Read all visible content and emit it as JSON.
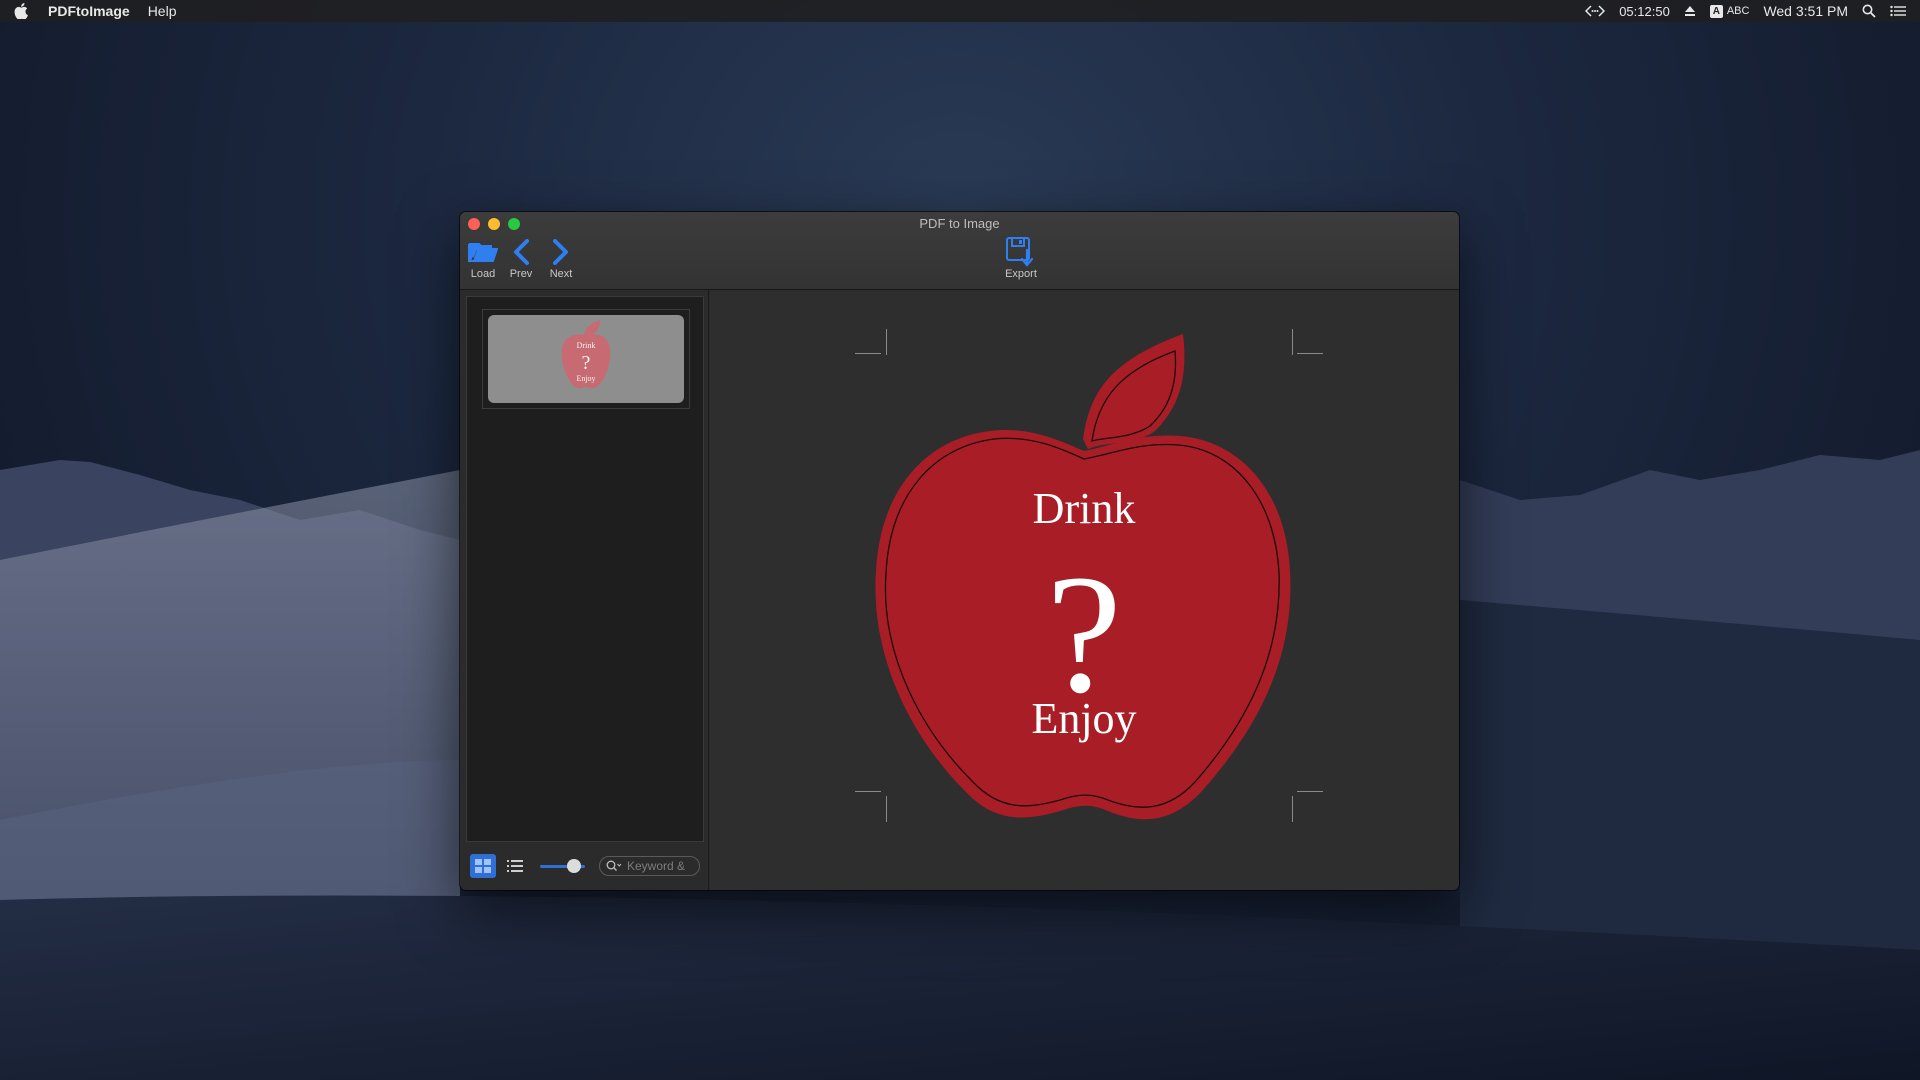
{
  "menubar": {
    "app_name": "PDFtoImage",
    "menus": [
      "Help"
    ],
    "clock_timer": "05:12:50",
    "input_source": "ABC",
    "input_badge": "A",
    "datetime": "Wed 3:51 PM"
  },
  "window": {
    "title": "PDF to Image",
    "toolbar": {
      "load_label": "Load",
      "prev_label": "Prev",
      "next_label": "Next",
      "export_label": "Export"
    },
    "sidebar": {
      "search_placeholder": "Keyword &",
      "slider_level": 0.8,
      "active_view": "grid"
    },
    "page": {
      "line1": "Drink",
      "line2": "?",
      "line3": "Enjoy"
    },
    "colors": {
      "apple_red": "#a91e26",
      "thumb_red": "#c86a72",
      "accent_blue": "#2f6fd6"
    }
  }
}
